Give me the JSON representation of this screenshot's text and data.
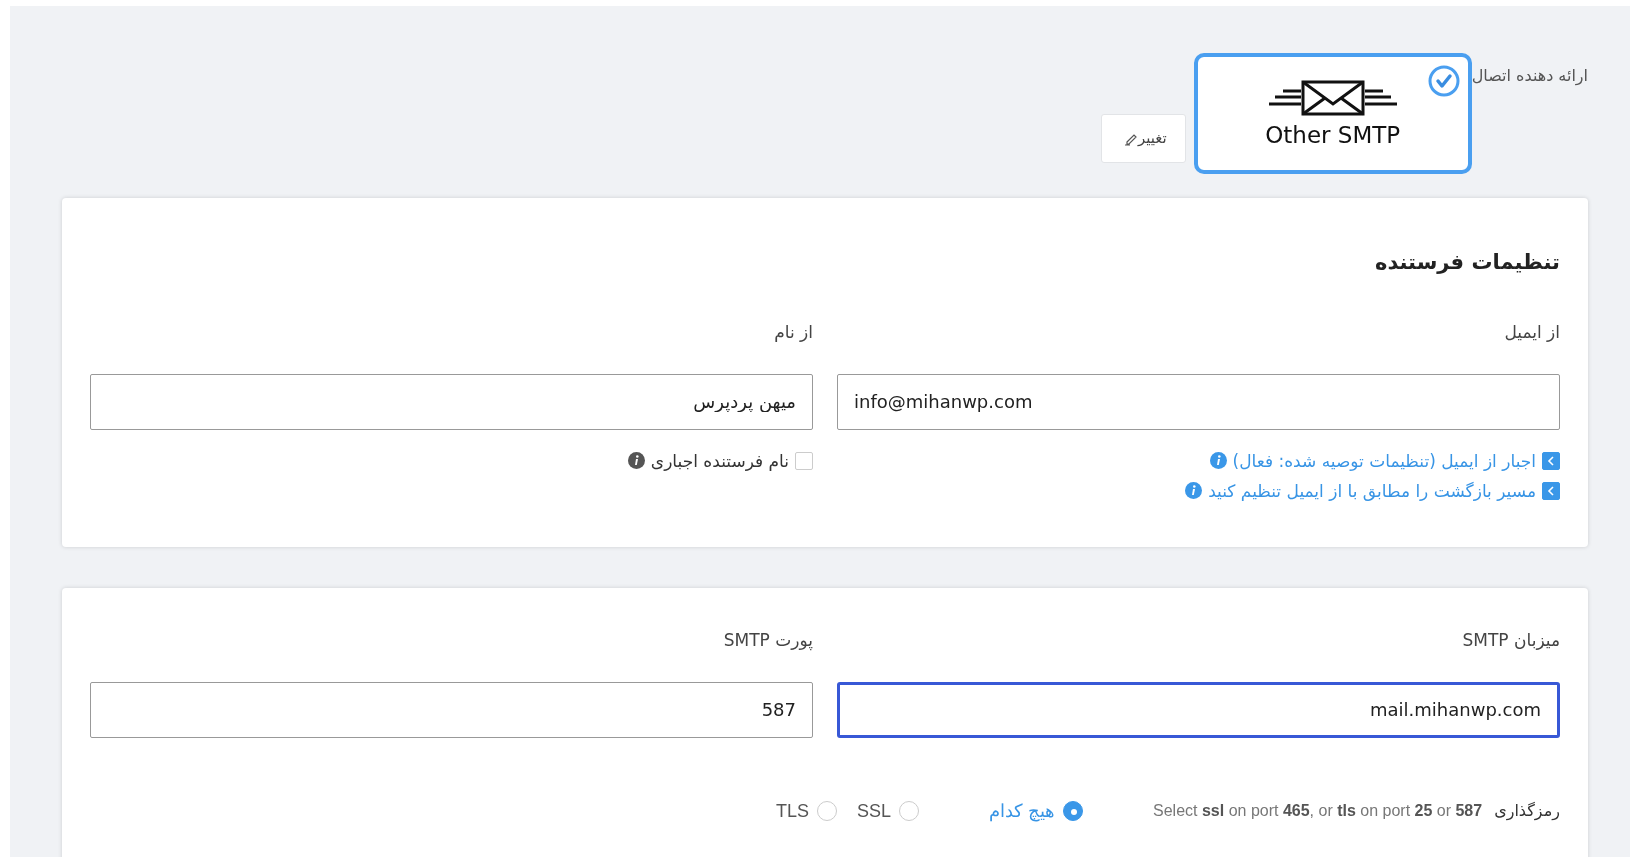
{
  "provider": {
    "label": "ارائه دهنده اتصال",
    "name": "Other SMTP",
    "selected": true,
    "change_button": "تغییر"
  },
  "sender_settings": {
    "title": "تنظیمات فرستنده",
    "fields": [
      {
        "label": "از ایمیل",
        "value": "info@mihanwp.com",
        "options": [
          {
            "label": "اجبار از ایمیل (تنظیمات توصیه شده: فعال)",
            "checked": true
          },
          {
            "label": "مسیر بازگشت را مطابق با از ایمیل تنظیم کنید",
            "checked": true
          }
        ]
      },
      {
        "label": "از نام",
        "value": "میهن پردپرس",
        "options": [
          {
            "label": "نام فرستنده اجباری",
            "checked": false
          }
        ]
      }
    ]
  },
  "smtp": {
    "fields": [
      {
        "label": "میزبان SMTP",
        "value": "mail.mihanwp.com",
        "focused": true
      },
      {
        "label": "پورت SMTP",
        "value": "587",
        "focused": false
      }
    ],
    "encryption": {
      "label": "رمزگذاری",
      "hint": "Select **ssl** on port **465**, or **tls** on port **25** or **587**",
      "choices": [
        {
          "label": "هیچ کدام",
          "selected": true
        },
        {
          "label": "SSL",
          "selected": false
        },
        {
          "label": "TLS",
          "selected": false
        }
      ]
    }
  }
}
